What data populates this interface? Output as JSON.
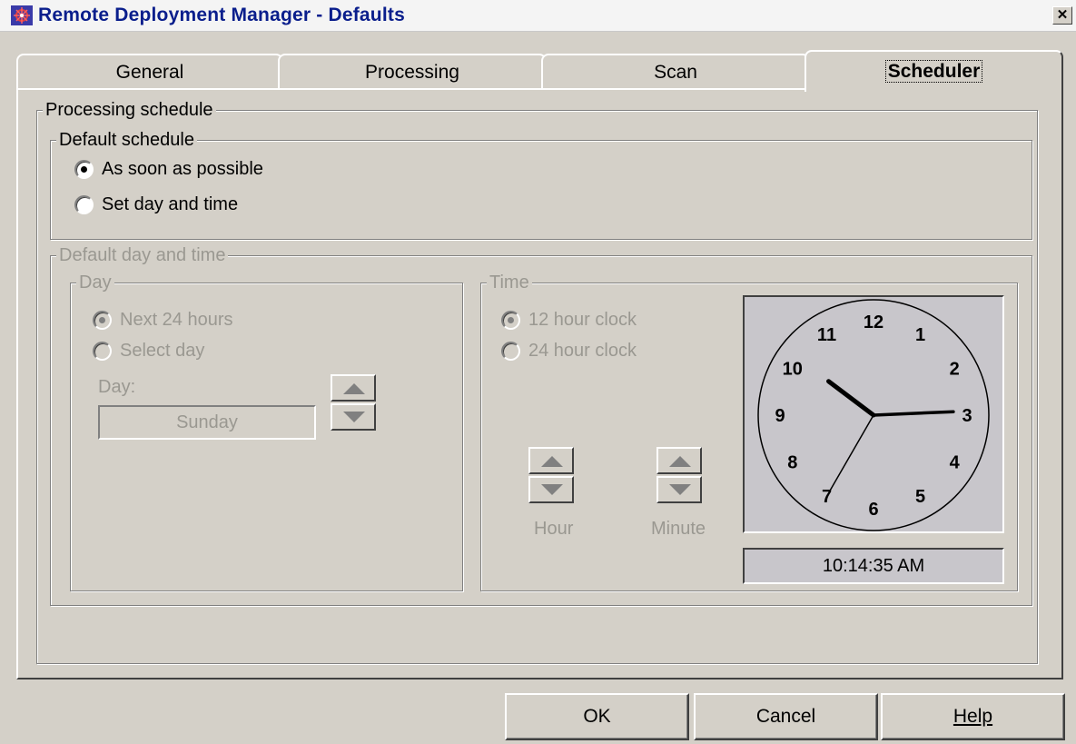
{
  "window": {
    "title": "Remote Deployment Manager - Defaults",
    "close_glyph": "✕"
  },
  "tabs": [
    {
      "label": "General",
      "active": false
    },
    {
      "label": "Processing",
      "active": false
    },
    {
      "label": "Scan",
      "active": false
    },
    {
      "label": "Scheduler",
      "active": true
    }
  ],
  "processing_schedule": {
    "label": "Processing schedule",
    "default_schedule": {
      "label": "Default schedule",
      "options": [
        {
          "label": "As soon as possible",
          "selected": true
        },
        {
          "label": "Set day and time",
          "selected": false
        }
      ]
    },
    "default_day_time": {
      "label": "Default day and time",
      "day_group": {
        "label": "Day",
        "options": [
          {
            "label": "Next 24 hours",
            "selected": true
          },
          {
            "label": "Select day",
            "selected": false
          }
        ],
        "day_label": "Day:",
        "day_value": "Sunday"
      },
      "time_group": {
        "label": "Time",
        "options": [
          {
            "label": "12 hour clock",
            "selected": true
          },
          {
            "label": "24 hour clock",
            "selected": false
          }
        ],
        "hour_label": "Hour",
        "minute_label": "Minute"
      },
      "clock": {
        "numerals": [
          "12",
          "1",
          "2",
          "3",
          "4",
          "5",
          "6",
          "7",
          "8",
          "9",
          "10",
          "11"
        ],
        "time_display": "10:14:35 AM",
        "hour": 10,
        "minute": 14,
        "second": 35
      }
    }
  },
  "buttons": {
    "ok": "OK",
    "cancel": "Cancel",
    "help": "Help"
  },
  "colors": {
    "title_text": "#0a1e8c",
    "face": "#d4d0c8",
    "disabled_text": "#9a9891"
  }
}
